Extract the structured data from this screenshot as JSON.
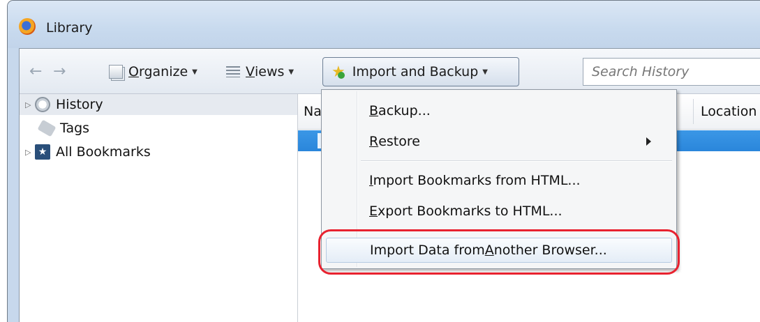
{
  "window": {
    "title": "Library"
  },
  "toolbar": {
    "organize": {
      "key": "O",
      "rest": "rganize"
    },
    "views": {
      "key": "V",
      "rest": "iews"
    },
    "import_backup": {
      "key": "I",
      "rest": "mport and Backup"
    },
    "search_placeholder": "Search History"
  },
  "sidebar": {
    "items": [
      {
        "label": "History",
        "selected": true,
        "expandable": true
      },
      {
        "label": "Tags",
        "selected": false,
        "expandable": false
      },
      {
        "label": "All Bookmarks",
        "selected": false,
        "expandable": true
      }
    ]
  },
  "columns": {
    "name": "Na",
    "location": "Location"
  },
  "menu": {
    "backup": {
      "key": "B",
      "rest": "ackup..."
    },
    "restore": {
      "key": "R",
      "rest": "estore"
    },
    "import_html": {
      "pre": "",
      "key": "I",
      "rest": "mport Bookmarks from HTML..."
    },
    "export_html": {
      "key": "E",
      "rest": "xport Bookmarks to HTML..."
    },
    "import_browser": {
      "pre": "Import Data from ",
      "key": "A",
      "rest": "nother Browser..."
    }
  },
  "colors": {
    "highlight_ring": "#e8222f",
    "selection": "#2a86db"
  }
}
